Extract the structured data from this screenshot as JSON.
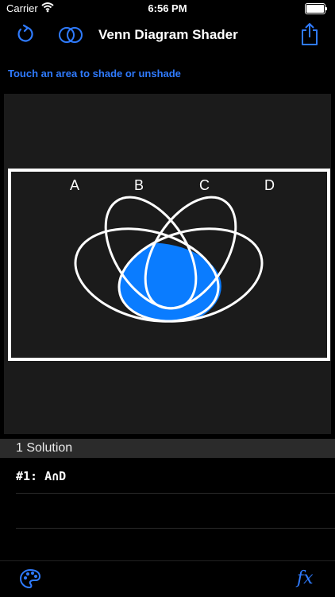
{
  "status": {
    "carrier": "Carrier",
    "time": "6:56 PM"
  },
  "nav": {
    "title": "Venn Diagram Shader"
  },
  "hint": "Touch an area to shade or unshade",
  "venn": {
    "labels": [
      "A",
      "B",
      "C",
      "D"
    ],
    "shaded_region": "A∩D",
    "shade_color": "#0a7cff"
  },
  "solutions": {
    "header": "1 Solution",
    "items": [
      "#1: A∩D"
    ]
  },
  "colors": {
    "accent": "#2f7bff"
  },
  "icons": [
    "refresh-icon",
    "venn-icon",
    "share-icon",
    "palette-icon",
    "function-icon"
  ]
}
